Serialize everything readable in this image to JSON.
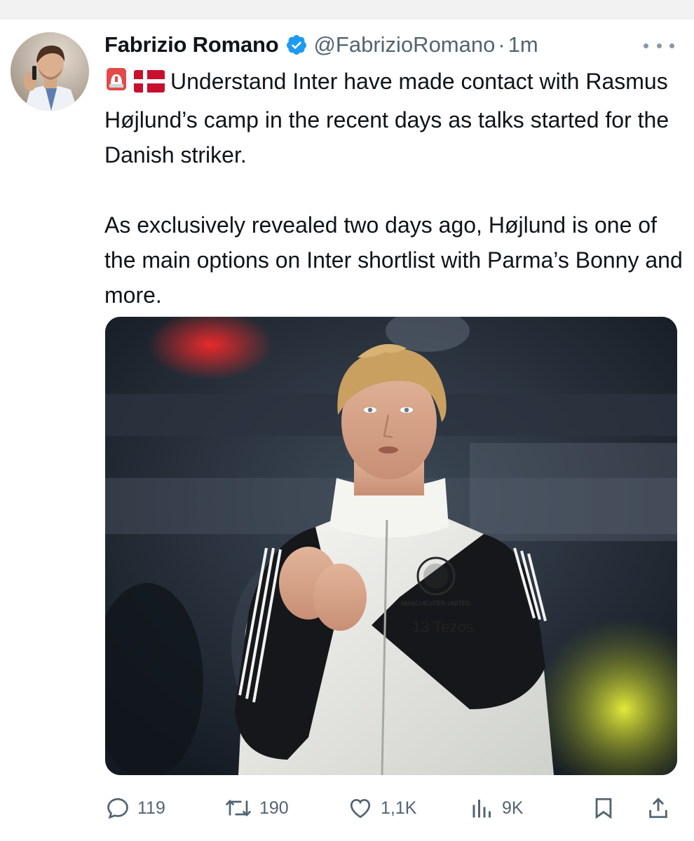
{
  "tweet": {
    "author": {
      "display_name": "Fabrizio Romano",
      "handle": "@FabrizioRomano",
      "verified": true,
      "avatar_icon": "profile-photo"
    },
    "separator": "·",
    "timestamp": "1m",
    "more_icon": "ellipsis-icon",
    "emojis": [
      "rotating-light",
      "denmark-flag"
    ],
    "paragraphs": [
      "Understand Inter have made contact with Rasmus Højlund’s camp in the recent days as talks started for the Danish striker.",
      "As exclusively revealed two days ago, Højlund is one of the main options on Inter shortlist with Parma’s Bonny and more."
    ],
    "media": {
      "jacket_text": "13 Tezos",
      "crest_text": "MANCHESTER UNITED"
    },
    "actions": {
      "replies": "119",
      "retweets": "190",
      "likes": "1,1K",
      "views": "9K"
    }
  },
  "colors": {
    "text": "#0f1419",
    "secondary": "#536471",
    "verified": "#1d9bf0",
    "siren": "#e0245e"
  }
}
